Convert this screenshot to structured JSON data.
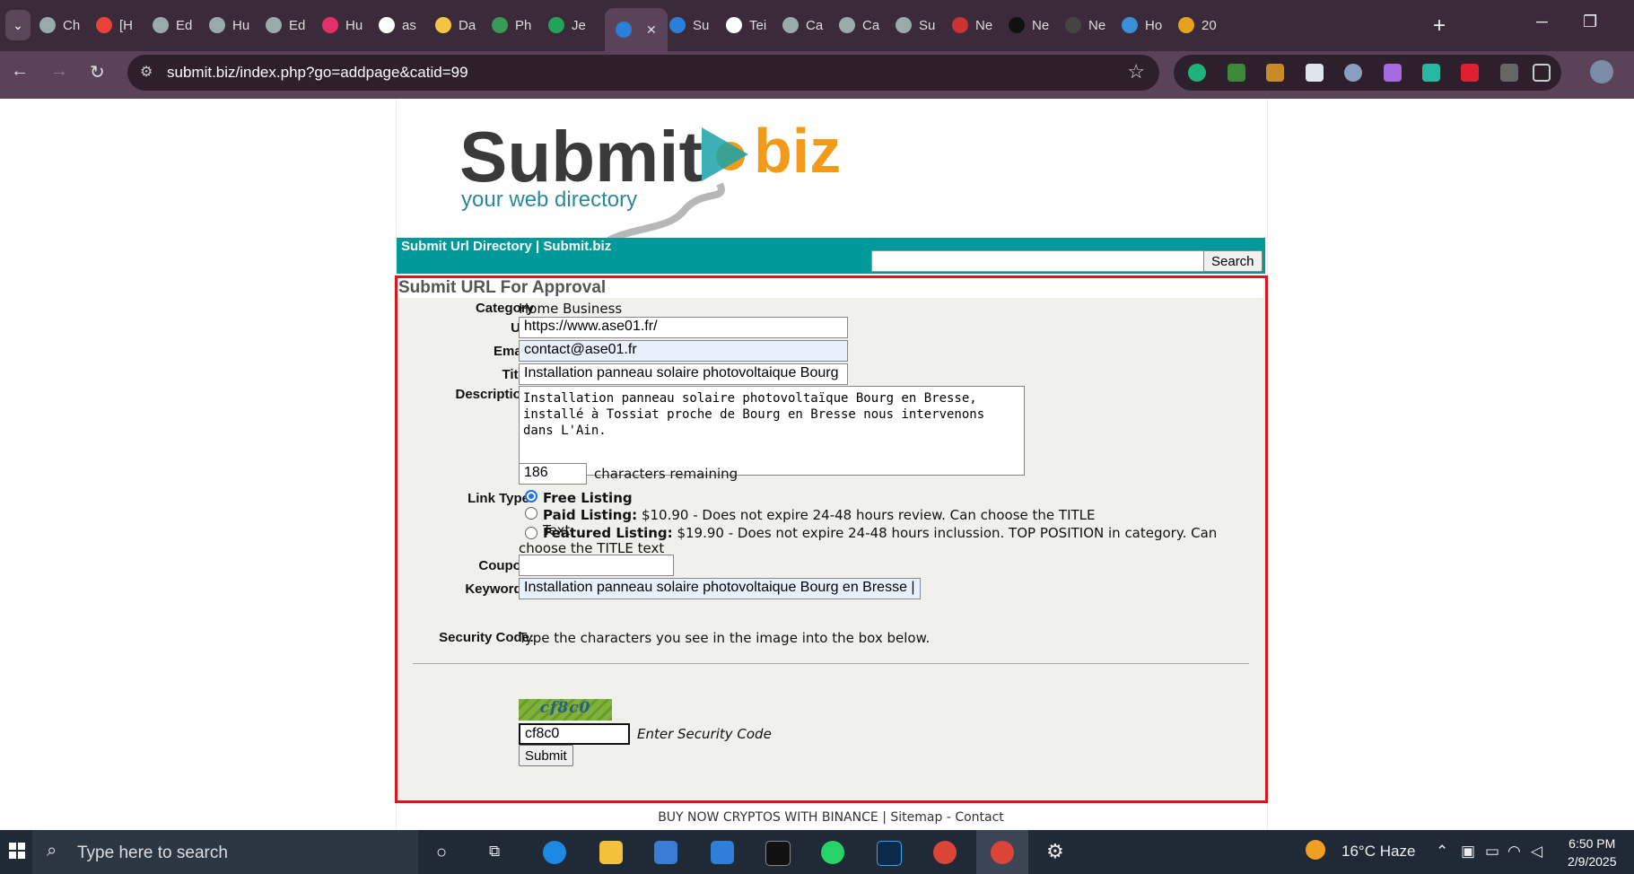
{
  "browser": {
    "tabs": [
      {
        "label": "Ch"
      },
      {
        "label": "[H"
      },
      {
        "label": "Ed"
      },
      {
        "label": "Hu"
      },
      {
        "label": "Ed"
      },
      {
        "label": "Hu"
      },
      {
        "label": "as"
      },
      {
        "label": "Da"
      },
      {
        "label": "Ph"
      },
      {
        "label": "Je"
      },
      {
        "label": "",
        "active": true
      },
      {
        "label": "Su"
      },
      {
        "label": "Tei"
      },
      {
        "label": "Ca"
      },
      {
        "label": "Ca"
      },
      {
        "label": "Su"
      },
      {
        "label": "Ne"
      },
      {
        "label": "Ne"
      },
      {
        "label": "Ne"
      },
      {
        "label": "Ho"
      },
      {
        "label": "20"
      }
    ],
    "url": "submit.biz/index.php?go=addpage&catid=99",
    "colors": {
      "tabbar": "#3b2a3a",
      "toolbar": "#5a4359",
      "highlight": "#e0141e",
      "teal": "#00999a"
    }
  },
  "site": {
    "logo_text_1": "Submit",
    "logo_text_2": "biz",
    "logo_tagline": "your web directory",
    "nav_title": "Submit Url Directory | Submit.biz",
    "search_button": "Search",
    "search_value": ""
  },
  "form": {
    "title": "Submit URL For Approval",
    "category_label": "Category",
    "category_value": "Home Business",
    "url_label": "Url:",
    "url_value": "https://www.ase01.fr/",
    "email_label": "Email:",
    "email_value": "contact@ase01.fr",
    "title_label": "Title:",
    "title_value": "Installation panneau solaire photovoltaique Bourg",
    "description_label": "Description:",
    "description_value": "Installation panneau solaire photovoltaïque Bourg en Bresse, installé à Tossiat proche de Bourg en Bresse nous intervenons dans L'Ain.",
    "chars_remaining_value": "186",
    "chars_remaining_text": "characters remaining",
    "linktype_label": "Link Type:",
    "link_options": [
      {
        "name": "Free Listing",
        "detail": "",
        "selected": true
      },
      {
        "name": "Paid Listing:",
        "detail": "$10.90 - Does not expire 24-48 hours review. Can choose the TITLE Text",
        "selected": false
      },
      {
        "name": "Featured Listing:",
        "detail": "$19.90 - Does not expire 24-48 hours inclussion. TOP POSITION in category. Can choose the TITLE text",
        "selected": false
      }
    ],
    "coupon_label": "Coupon:",
    "coupon_value": "",
    "keywords_label": "Keywords:",
    "keywords_value": "Installation panneau solaire photovoltaique Bourg en Bresse |",
    "security_label": "Security Code:",
    "security_instructions": "Type the characters you see in the image into the box below.",
    "captcha_text": "cf8c0",
    "security_value": "cf8c0",
    "security_hint": "Enter Security Code",
    "submit_label": "Submit"
  },
  "footer": {
    "link1": "BUY NOW CRYPTOS WITH BINANCE",
    "sep": "|",
    "link2": "Sitemap",
    "dash": "-",
    "link3": "Contact"
  },
  "taskbar": {
    "search_placeholder": "Type here to search",
    "weather": "16°C  Haze",
    "time": "6:50 PM",
    "date": "2/9/2025"
  }
}
